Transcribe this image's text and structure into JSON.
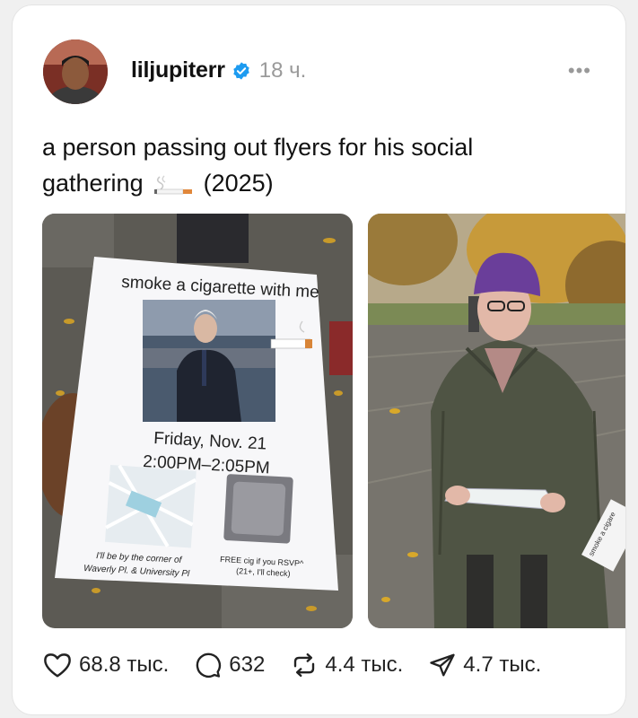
{
  "post": {
    "username": "liljupiterr",
    "time": "18 ч.",
    "caption_text": "a person passing out flyers for his social gathering",
    "caption_year": "(2025)"
  },
  "flyer": {
    "title": "smoke a cigarette with me",
    "date": "Friday, Nov. 21",
    "time_range": "2:00PM–2:05PM",
    "location_line1": "I'll be by the corner of",
    "location_line2": "Waverly Pl. & University Pl",
    "rsvp_line1": "FREE cig if you RSVP^",
    "rsvp_line2": "(21+, I'll check)"
  },
  "second_photo_sign": "smoke a cigare",
  "actions": {
    "likes": "68.8 тыс.",
    "comments": "632",
    "reposts": "4.4 тыс.",
    "shares": "4.7 тыс."
  },
  "colors": {
    "verified": "#1d9bf0",
    "text": "#111111",
    "muted": "#9a9a9a"
  }
}
